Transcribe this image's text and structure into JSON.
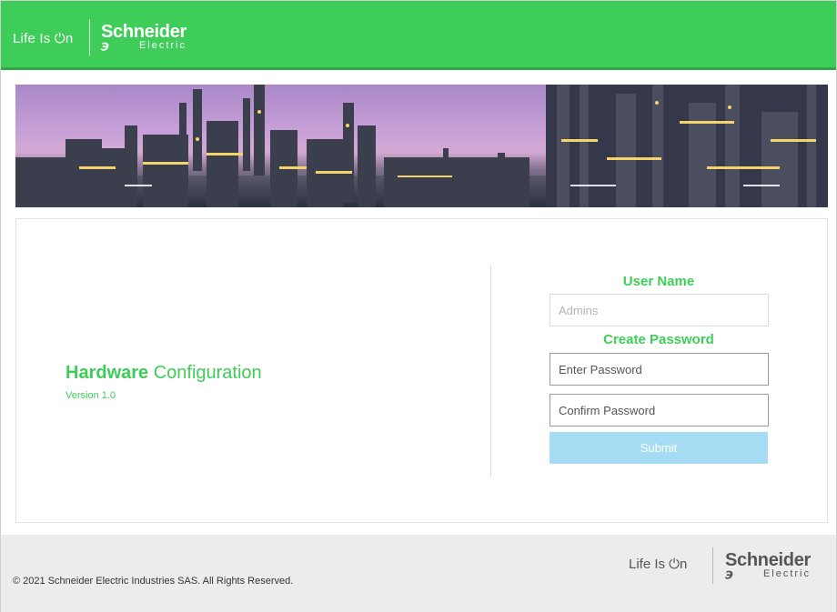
{
  "header": {
    "tagline": "Life Is ⏻n",
    "brand_name": "Schneider",
    "brand_sub": "Electric",
    "brand_logo": "℈"
  },
  "main": {
    "title_bold": "Hardware",
    "title_rest": " Configuration",
    "version": "Version 1.0"
  },
  "form": {
    "user_label": "User Name",
    "user_placeholder": "Admins",
    "password_label": "Create Password",
    "password_placeholder": "Enter Password",
    "confirm_placeholder": "Confirm Password",
    "submit_label": "Submit"
  },
  "footer": {
    "copyright": "© 2021 Schneider Electric Industries SAS. All Rights Reserved.",
    "tagline": "Life Is ⏻n",
    "brand_name": "Schneider",
    "brand_sub": "Electric",
    "brand_logo": "℈"
  },
  "colors": {
    "brand_green": "#3dcd58",
    "submit_disabled": "#a6dcf3",
    "footer_bg": "#ececec"
  }
}
